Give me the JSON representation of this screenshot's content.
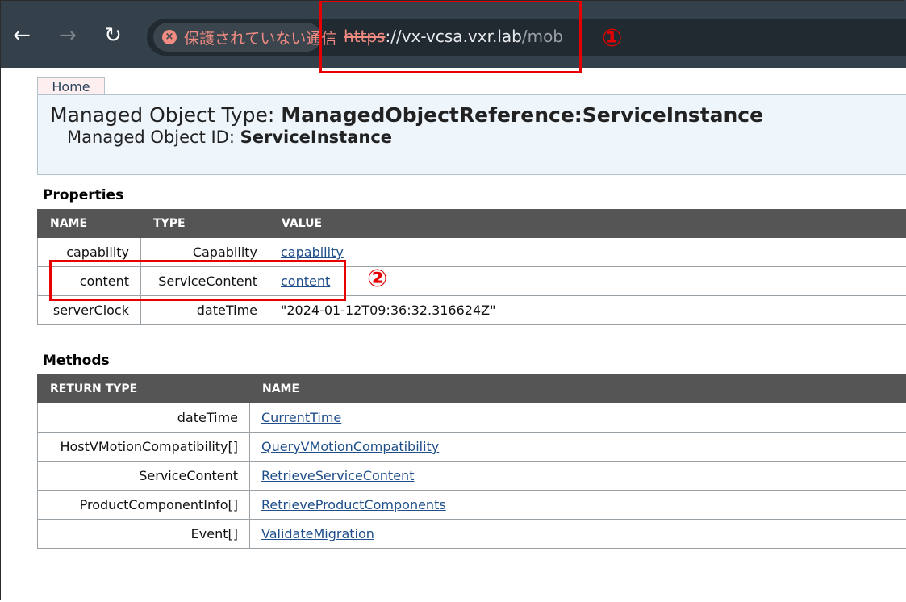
{
  "browser": {
    "security_warning": "保護されていない通信",
    "url_scheme": "https",
    "url_sep": "://",
    "url_host": "vx-vcsa.vxr.lab",
    "url_path": "/mob"
  },
  "annotations": {
    "mark1": "①",
    "mark2": "②",
    "color": "#e60000"
  },
  "page": {
    "home_tab": "Home",
    "mo_type_label": "Managed Object Type: ",
    "mo_type_value": "ManagedObjectReference:ServiceInstance",
    "mo_id_label": "Managed Object ID: ",
    "mo_id_value": "ServiceInstance"
  },
  "properties": {
    "title": "Properties",
    "headers": [
      "NAME",
      "TYPE",
      "VALUE"
    ],
    "rows": [
      {
        "name": "capability",
        "type": "Capability",
        "value": "capability"
      },
      {
        "name": "content",
        "type": "ServiceContent",
        "value": "content"
      },
      {
        "name": "serverClock",
        "type": "dateTime",
        "value": "\"2024-01-12T09:36:32.316624Z\""
      }
    ]
  },
  "methods": {
    "title": "Methods",
    "headers": [
      "RETURN TYPE",
      "NAME"
    ],
    "rows": [
      {
        "return_type": "dateTime",
        "name": "CurrentTime"
      },
      {
        "return_type": "HostVMotionCompatibility[]",
        "name": "QueryVMotionCompatibility"
      },
      {
        "return_type": "ServiceContent",
        "name": "RetrieveServiceContent"
      },
      {
        "return_type": "ProductComponentInfo[]",
        "name": "RetrieveProductComponents"
      },
      {
        "return_type": "Event[]",
        "name": "ValidateMigration"
      }
    ]
  }
}
